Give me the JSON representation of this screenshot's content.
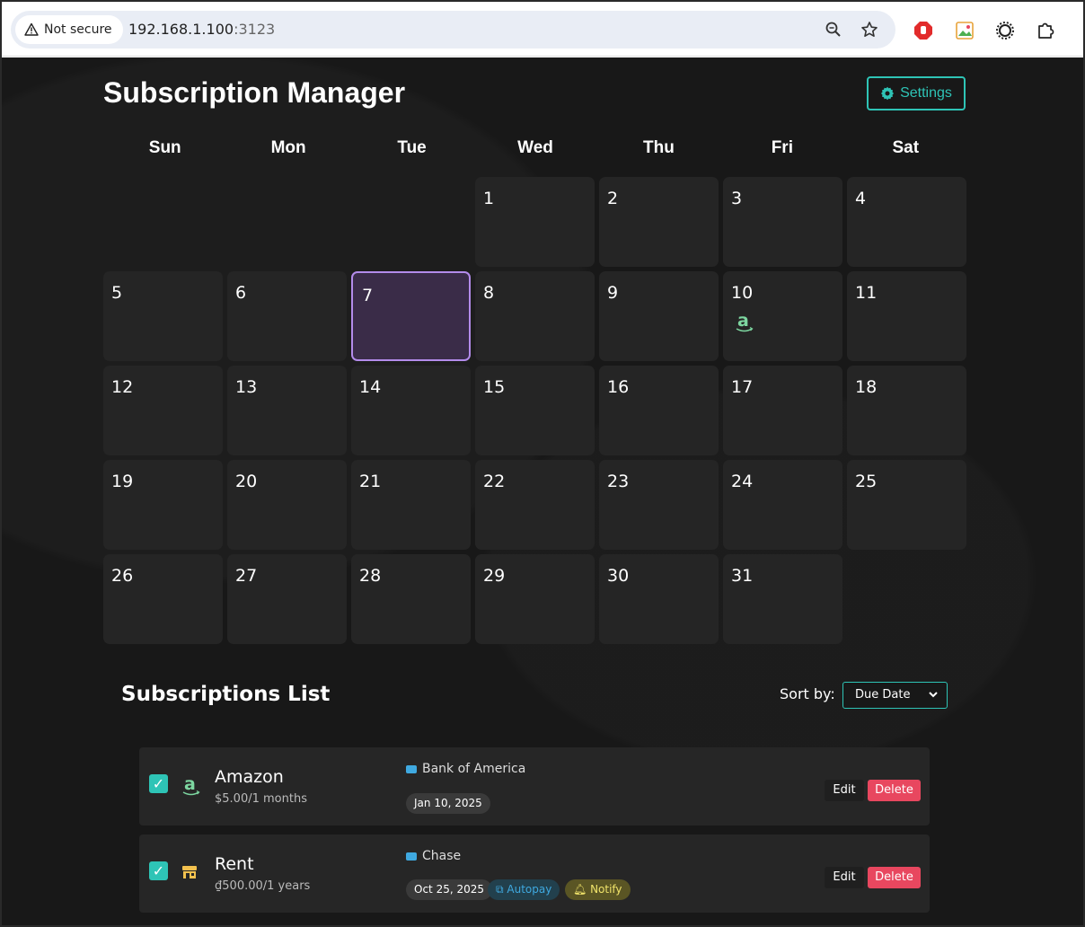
{
  "browser": {
    "security_label": "Not secure",
    "url_host": "192.168.1.100",
    "url_port": ":3123"
  },
  "app": {
    "title": "Subscription Manager",
    "settings_label": "Settings"
  },
  "calendar": {
    "weekdays": [
      "Sun",
      "Mon",
      "Tue",
      "Wed",
      "Thu",
      "Fri",
      "Sat"
    ],
    "leading_blank_days": 3,
    "days_in_month": 31,
    "today": 7,
    "subscription_days": [
      {
        "day": 10,
        "icon": "amazon-icon"
      }
    ]
  },
  "list": {
    "title": "Subscriptions List",
    "sort_label": "Sort by:",
    "sort_value": "Due Date",
    "edit_label": "Edit",
    "delete_label": "Delete",
    "items": [
      {
        "name": "Amazon",
        "price": "$5.00/1 months",
        "icon": "amazon-icon",
        "bank": "Bank of America",
        "due": "Jan 10, 2025",
        "autopay": null,
        "notify": null,
        "checked": true
      },
      {
        "name": "Rent",
        "price": "₫500.00/1 years",
        "icon": "store-icon",
        "bank": "Chase",
        "due": "Oct 25, 2025",
        "autopay": "Autopay",
        "notify": "Notify",
        "checked": true
      }
    ]
  },
  "colors": {
    "accent": "#2ec4b6",
    "today_border": "#b38bea",
    "delete": "#e8475f",
    "background": "#181818",
    "cell": "#252525"
  }
}
